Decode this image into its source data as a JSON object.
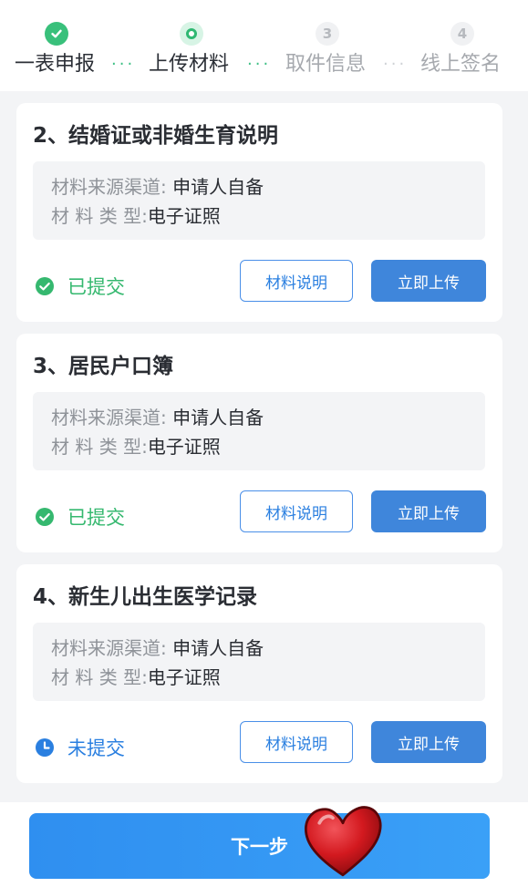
{
  "steps": [
    {
      "label": "一表申报",
      "number": "",
      "state": "done"
    },
    {
      "label": "上传材料",
      "number": "",
      "state": "current"
    },
    {
      "label": "取件信息",
      "number": "3",
      "state": "future"
    },
    {
      "label": "线上签名",
      "number": "4",
      "state": "future"
    }
  ],
  "step_separator": "···",
  "materials": [
    {
      "title": "2、结婚证或非婚生育说明",
      "source_label": "材料来源渠道:",
      "source_value": "申请人自备",
      "type_label": "材 料 类 型:",
      "type_value": "电子证照",
      "status": "已提交",
      "status_icon": "check-circle-icon",
      "explain_button": "材料说明",
      "upload_button": "立即上传"
    },
    {
      "title": "3、居民户口簿",
      "source_label": "材料来源渠道:",
      "source_value": "申请人自备",
      "type_label": "材 料 类 型:",
      "type_value": "电子证照",
      "status": "已提交",
      "status_icon": "check-circle-icon",
      "explain_button": "材料说明",
      "upload_button": "立即上传"
    },
    {
      "title": "4、新生儿出生医学记录",
      "source_label": "材料来源渠道:",
      "source_value": "申请人自备",
      "type_label": "材 料 类 型:",
      "type_value": "电子证照",
      "status": "未提交",
      "status_icon": "clock-icon",
      "explain_button": "材料说明",
      "upload_button": "立即上传"
    }
  ],
  "next_button": "下一步",
  "colors": {
    "done_green": "#39c07b",
    "pending_blue": "#2a7fe0",
    "primary_button": "#3f86db",
    "heart_red": "#d3191f"
  }
}
